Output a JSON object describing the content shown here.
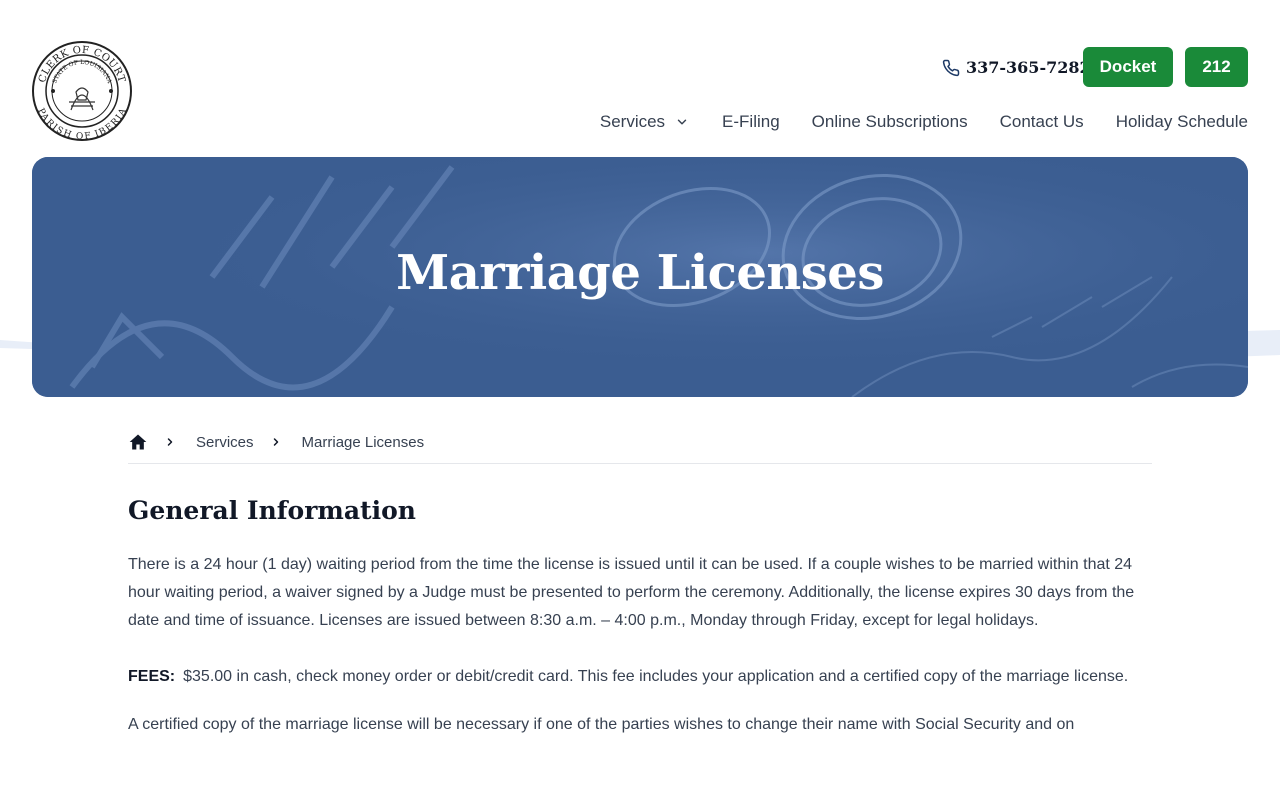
{
  "header": {
    "logo_text_top": "CLERK OF COURT",
    "logo_text_inner": "STATE OF LOUISIANA",
    "logo_text_bottom": "PARISH OF IBERIA",
    "phone": "337-365-7282",
    "docket_label": "Docket",
    "btn212_label": "212"
  },
  "nav": {
    "items": [
      {
        "label": "Services"
      },
      {
        "label": "E-Filing"
      },
      {
        "label": "Online Subscriptions"
      },
      {
        "label": "Contact Us"
      },
      {
        "label": "Holiday Schedule"
      }
    ]
  },
  "hero": {
    "title": "Marriage Licenses"
  },
  "breadcrumb": {
    "items": [
      "Services",
      "Marriage Licenses"
    ]
  },
  "content": {
    "heading": "General Information",
    "para1": "There is a 24 hour (1 day) waiting period from the time the license is issued until it can be used.  If a couple wishes to be married within that 24 hour waiting period, a waiver signed by a Judge must be presented to perform the ceremony.  Additionally, the license expires 30 days from the date and time of issuance.  Licenses are issued between 8:30 a.m. – 4:00 p.m., Monday through Friday, except for legal holidays.",
    "fees_label": "FEES:",
    "fees_text": "$35.00 in cash, check money order or debit/credit card.  This fee includes your application and a certified copy of the marriage license.",
    "para3": "A certified copy of the marriage license will be necessary if one of the parties wishes to change their name with Social Security and on"
  },
  "colors": {
    "accent_green": "#1a8a39",
    "hero_blue": "#3b5d91"
  },
  "icons": {
    "phone": "phone-icon",
    "chevron": "chevron-down-icon",
    "home": "home-icon",
    "separator": "chevron-right-icon"
  }
}
